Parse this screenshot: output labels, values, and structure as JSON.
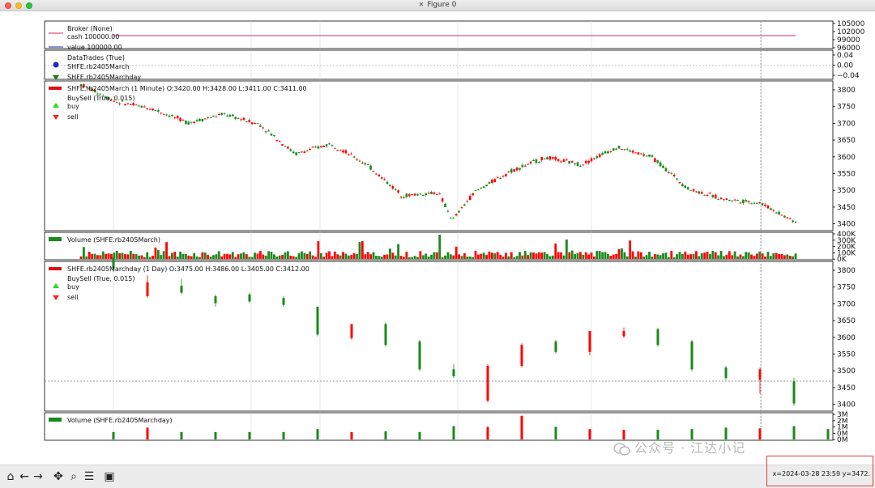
{
  "window": {
    "title": "Figure 0"
  },
  "panels": {
    "broker": {
      "legend": [
        "Broker (None)",
        "cash 100000.00",
        "value 100000.00"
      ],
      "yticks": [
        "105000",
        "102000",
        "99000",
        "96000"
      ],
      "colors": [
        "#e0245e",
        "#e0245e",
        "#1f2a9b"
      ]
    },
    "trades": {
      "legend": [
        "DataTrades (True)",
        "SHFE.rb2405March",
        "SHFE.rb2405Marchday"
      ],
      "yticks": [
        "0.04",
        "0.00",
        "−0.04"
      ]
    },
    "main": {
      "legend_title": "SHFE.rb2405March (1 Minute) O:3420.00 H:3428.00 L:3411.00 C:3411.00",
      "legend": [
        "BuySell (True, 0.015)",
        "buy",
        "sell"
      ],
      "yticks": [
        "3800",
        "3750",
        "3700",
        "3650",
        "3600",
        "3550",
        "3500",
        "3450",
        "3400"
      ]
    },
    "volume1": {
      "legend": "Volume (SHFE.rb2405March)",
      "yticks": [
        "400K",
        "300K",
        "200K",
        "100K",
        "0K"
      ]
    },
    "daily": {
      "legend_title": "SHFE.rb2405Marchday (1 Day) O:3475.00 H:3486.00 L:3405.00 C:3412.00",
      "legend": [
        "BuySell (True, 0.015)",
        "buy",
        "sell"
      ],
      "yticks": [
        "3800",
        "3750",
        "3700",
        "3650",
        "3600",
        "3550",
        "3500",
        "3450",
        "3400"
      ]
    },
    "volume2": {
      "legend": "Volume (SHFE.rb2405Marchday)",
      "yticks": [
        "3M",
        "2M",
        "1M",
        "0M",
        "0M"
      ]
    }
  },
  "chart_data": [
    {
      "type": "line",
      "legend": [
        "Broker (None)",
        "cash 100000.00",
        "value 100000.00"
      ],
      "series": [
        {
          "name": "cash",
          "value": 100000
        },
        {
          "name": "value",
          "value": 100000
        }
      ],
      "ylim": [
        96000,
        105000
      ]
    },
    {
      "type": "line",
      "legend_title": "SHFE.rb2405March (1 Minute) O:3420.00 H:3428.00 L:3411.00 C:3411.00",
      "x": [
        0,
        0.05,
        0.1,
        0.15,
        0.2,
        0.25,
        0.3,
        0.35,
        0.4,
        0.45,
        0.5,
        0.52,
        0.55,
        0.6,
        0.65,
        0.7,
        0.75,
        0.8,
        0.85,
        0.9,
        0.95,
        1
      ],
      "y": [
        3810,
        3760,
        3740,
        3700,
        3725,
        3695,
        3610,
        3640,
        3580,
        3490,
        3500,
        3420,
        3500,
        3560,
        3600,
        3580,
        3630,
        3600,
        3510,
        3480,
        3470,
        3415
      ],
      "ylim": [
        3390,
        3820
      ]
    },
    {
      "type": "bar",
      "legend_title": "SHFE.rb2405Marchday (1 Day) O:3475.00 H:3486.00 L:3405.00 C:3412.00",
      "candles": [
        {
          "o": 3830,
          "c": 3800,
          "h": 3835,
          "l": 3790,
          "up": false
        },
        {
          "o": 3760,
          "c": 3720,
          "h": 3780,
          "l": 3715,
          "up": true
        },
        {
          "o": 3750,
          "c": 3730,
          "h": 3770,
          "l": 3725,
          "up": false
        },
        {
          "o": 3720,
          "c": 3700,
          "h": 3725,
          "l": 3690,
          "up": false
        },
        {
          "o": 3725,
          "c": 3705,
          "h": 3730,
          "l": 3700,
          "up": false
        },
        {
          "o": 3715,
          "c": 3695,
          "h": 3720,
          "l": 3690,
          "up": false
        },
        {
          "o": 3690,
          "c": 3610,
          "h": 3690,
          "l": 3605,
          "up": false
        },
        {
          "o": 3600,
          "c": 3640,
          "h": 3640,
          "l": 3595,
          "up": true
        },
        {
          "o": 3640,
          "c": 3580,
          "h": 3645,
          "l": 3575,
          "up": false
        },
        {
          "o": 3590,
          "c": 3510,
          "h": 3595,
          "l": 3505,
          "up": false
        },
        {
          "o": 3510,
          "c": 3490,
          "h": 3525,
          "l": 3485,
          "up": false
        },
        {
          "o": 3420,
          "c": 3520,
          "h": 3525,
          "l": 3415,
          "up": true
        },
        {
          "o": 3520,
          "c": 3580,
          "h": 3585,
          "l": 3515,
          "up": true
        },
        {
          "o": 3590,
          "c": 3560,
          "h": 3595,
          "l": 3555,
          "up": false
        },
        {
          "o": 3560,
          "c": 3620,
          "h": 3620,
          "l": 3550,
          "up": true
        },
        {
          "o": 3605,
          "c": 3620,
          "h": 3630,
          "l": 3600,
          "up": true
        },
        {
          "o": 3625,
          "c": 3580,
          "h": 3630,
          "l": 3575,
          "up": false
        },
        {
          "o": 3590,
          "c": 3510,
          "h": 3595,
          "l": 3505,
          "up": false
        },
        {
          "o": 3515,
          "c": 3485,
          "h": 3520,
          "l": 3480,
          "up": false
        },
        {
          "o": 3480,
          "c": 3510,
          "h": 3515,
          "l": 3440,
          "up": true
        },
        {
          "o": 3475,
          "c": 3412,
          "h": 3486,
          "l": 3405,
          "up": false
        }
      ],
      "volumes": [
        1.0,
        1.6,
        1.0,
        1.0,
        1.0,
        1.0,
        1.4,
        1.0,
        1.1,
        1.0,
        1.8,
        1.7,
        3.2,
        1.7,
        1.4,
        1.3,
        1.3,
        1.4,
        1.6,
        1.5,
        1.8,
        1.4
      ],
      "ylim": [
        3390,
        3820
      ]
    }
  ],
  "toolbar": {
    "home": "⌂",
    "back": "←",
    "forward": "→",
    "pan": "✥",
    "zoom": "⌕",
    "config": "☰",
    "save": "▣",
    "coords": "x=2024-03-28 23:59 y=3472."
  },
  "watermark": "公众号 · 江达小记"
}
